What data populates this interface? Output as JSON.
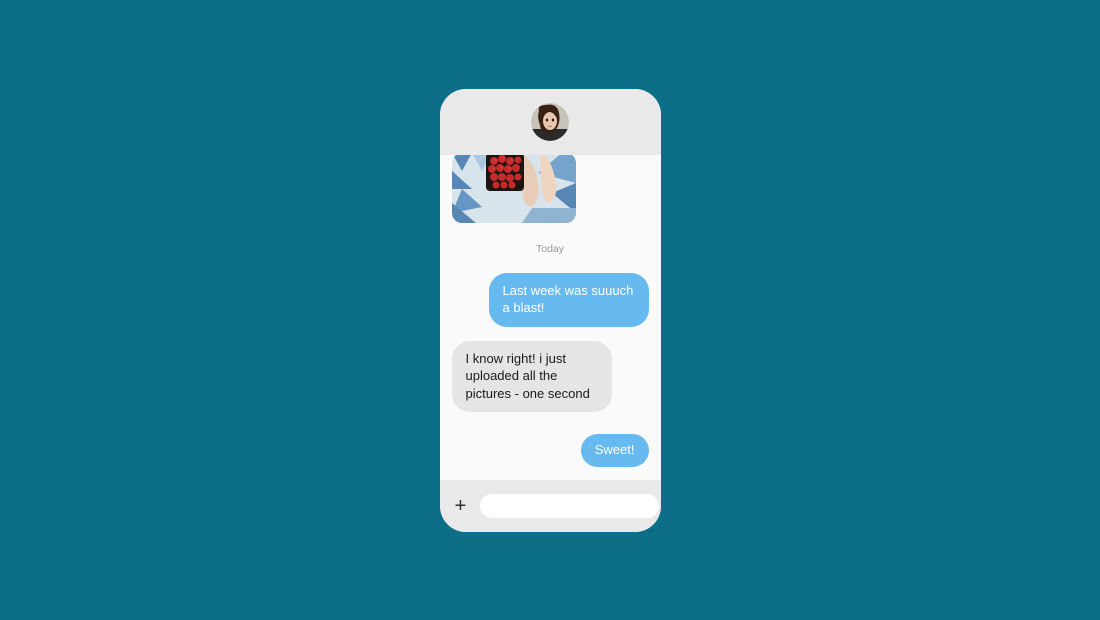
{
  "chat": {
    "timestamp": "Today",
    "messages": [
      {
        "type": "sent",
        "text": "Last week was suuuch a blast!"
      },
      {
        "type": "received",
        "text": "I know right! i just uploaded all the pictures - one second"
      },
      {
        "type": "sent",
        "text": "Sweet!"
      }
    ]
  },
  "input": {
    "placeholder": ""
  },
  "colors": {
    "background": "#0d6f87",
    "sent_bubble": "#67baef",
    "received_bubble": "#e5e5e5"
  }
}
